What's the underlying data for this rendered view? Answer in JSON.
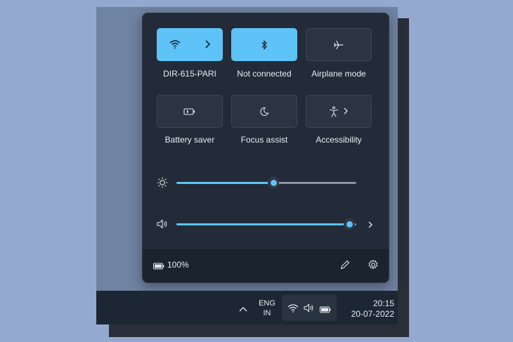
{
  "quick_settings": {
    "tiles": [
      {
        "label": "DIR-615-PARI",
        "icon": "wifi-icon",
        "state": "on",
        "has_chevron": true
      },
      {
        "label": "Not connected",
        "icon": "bluetooth-icon",
        "state": "on",
        "has_chevron": false
      },
      {
        "label": "Airplane mode",
        "icon": "airplane-icon",
        "state": "off",
        "has_chevron": false
      },
      {
        "label": "Battery saver",
        "icon": "battery-saver-icon",
        "state": "off",
        "has_chevron": false
      },
      {
        "label": "Focus assist",
        "icon": "moon-icon",
        "state": "off",
        "has_chevron": false
      },
      {
        "label": "Accessibility",
        "icon": "accessibility-icon",
        "state": "off",
        "has_chevron": true
      }
    ],
    "brightness": {
      "icon": "brightness-icon",
      "level": 0.54
    },
    "volume": {
      "icon": "speaker-icon",
      "level": 0.96
    },
    "footer": {
      "battery_icon": "battery-icon",
      "battery_percent": "100%",
      "edit_icon": "pencil-icon",
      "settings_icon": "gear-icon"
    },
    "colors": {
      "accent": "#5ec3f6",
      "panel": "#222b37",
      "tile_off": "#2b3441"
    }
  },
  "taskbar": {
    "chevron_icon": "chevron-up-icon",
    "language": {
      "line1": "ENG",
      "line2": "IN"
    },
    "tray_icons": [
      "wifi-icon",
      "speaker-icon",
      "battery-icon"
    ],
    "clock": {
      "time": "20:15",
      "date": "20-07-2022"
    }
  }
}
